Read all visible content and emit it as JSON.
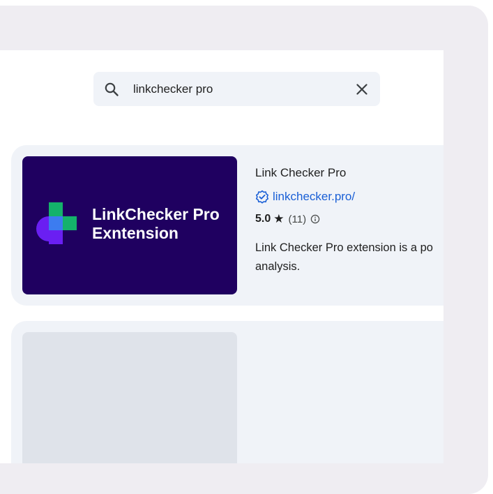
{
  "search": {
    "query": "linkchecker pro"
  },
  "results": [
    {
      "thumbnail": {
        "brand_line_1": "LinkChecker Pro",
        "brand_line_2": "Exntension",
        "colors": {
          "background": "#1f0060",
          "green": "#14b26b",
          "blue": "#3c7cf0",
          "violet": "#6a1ff2"
        }
      },
      "title": "Link Checker Pro",
      "domain": "linkchecker.pro/",
      "rating": {
        "score": "5.0",
        "count": "(11)"
      },
      "description_lines": [
        "Link Checker Pro extension is a po",
        "analysis."
      ]
    }
  ],
  "colors": {
    "frame": "#efedf2",
    "card": "#f0f3f8",
    "placeholder": "#dfe3ea",
    "link": "#1a5fd6"
  },
  "icons": {
    "search": "magnifier",
    "clear": "close-x",
    "verified": "verified-badge",
    "star": "★",
    "info": "info-circle"
  }
}
